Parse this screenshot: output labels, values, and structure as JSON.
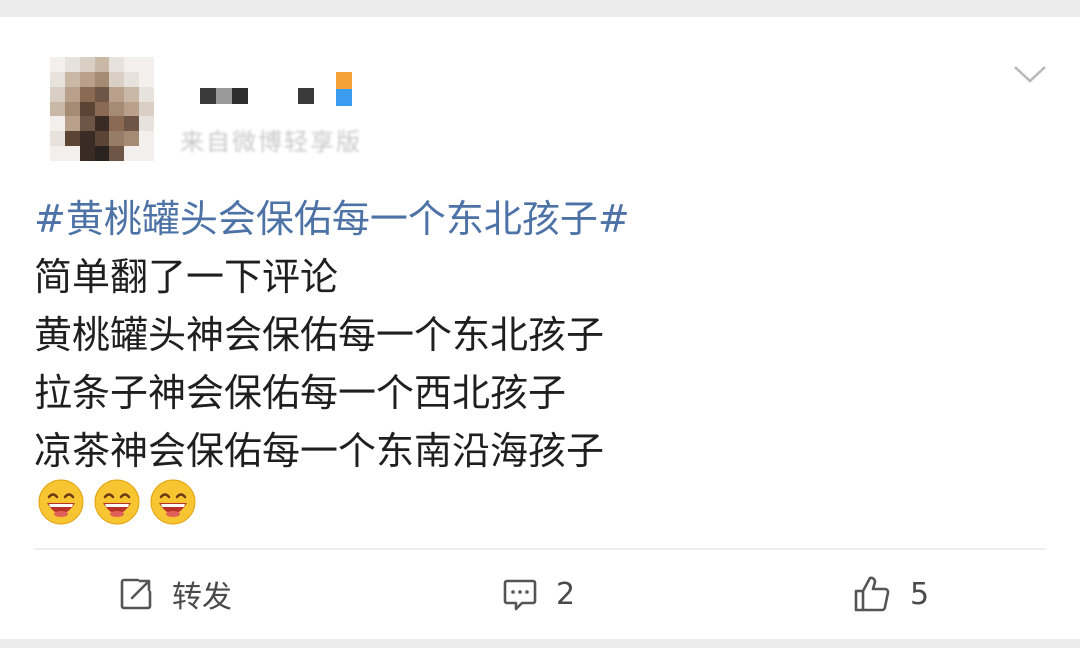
{
  "post": {
    "topic": "#黄桃罐头会保佑每一个东北孩子#",
    "lines": [
      "简单翻了一下评论",
      "黄桃罐头神会保佑每一个东北孩子",
      "拉条子神会保佑每一个西北孩子",
      "凉茶神会保佑每一个东南沿海孩子"
    ],
    "emojis": [
      "laughing-face-icon",
      "laughing-face-icon",
      "laughing-face-icon"
    ]
  },
  "author": {
    "meta": "来自微博轻享版"
  },
  "actions": {
    "repost_label": "转发",
    "comment_count": "2",
    "like_count": "5"
  },
  "colors": {
    "topic": "#4d73a6",
    "text": "#1f1f1f",
    "action": "#4a4a4a",
    "background": "#ececec",
    "card": "#ffffff"
  }
}
